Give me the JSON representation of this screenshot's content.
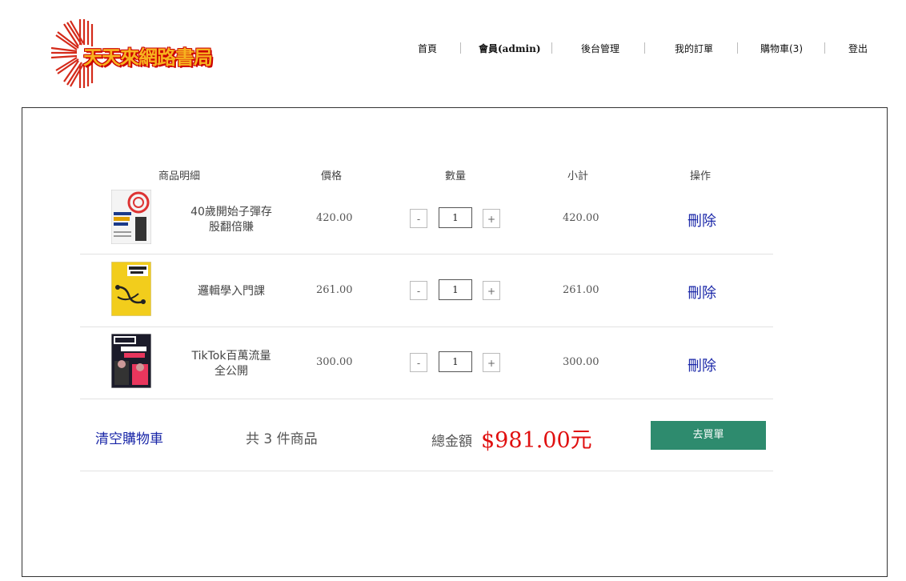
{
  "brand": {
    "logo_text": "天天來網路書局"
  },
  "nav": {
    "home": "首頁",
    "member": "會員(admin)",
    "admin": "後台管理",
    "orders": "我的訂單",
    "cart": "購物車(3)",
    "logout": "登出"
  },
  "cart": {
    "headers": {
      "item": "商品明細",
      "price": "價格",
      "qty": "數量",
      "subtotal": "小計",
      "action": "操作"
    },
    "items": [
      {
        "title_line1": "40歲開始子彈存",
        "title_line2": "股翻倍賺",
        "price": "420.00",
        "qty": "1",
        "subtotal": "420.00",
        "delete_label": "刪除",
        "minus": "-",
        "plus": "+"
      },
      {
        "title_line1": "邏輯學入門課",
        "title_line2": "",
        "price": "261.00",
        "qty": "1",
        "subtotal": "261.00",
        "delete_label": "刪除",
        "minus": "-",
        "plus": "+"
      },
      {
        "title_line1": "TikTok百萬流量",
        "title_line2": "全公開",
        "price": "300.00",
        "qty": "1",
        "subtotal": "300.00",
        "delete_label": "刪除",
        "minus": "-",
        "plus": "+"
      }
    ],
    "clear_label": "清空購物車",
    "count_text": "共 3 件商品",
    "total_label": "總金額",
    "total_value": "$981.00元",
    "buy_label": "去買單"
  },
  "colors": {
    "accent_green": "#2e8b6e",
    "link_blue": "#1a27a8",
    "total_red": "#e01010",
    "logo_orange": "#f7b21f",
    "logo_red": "#d42a1a"
  }
}
